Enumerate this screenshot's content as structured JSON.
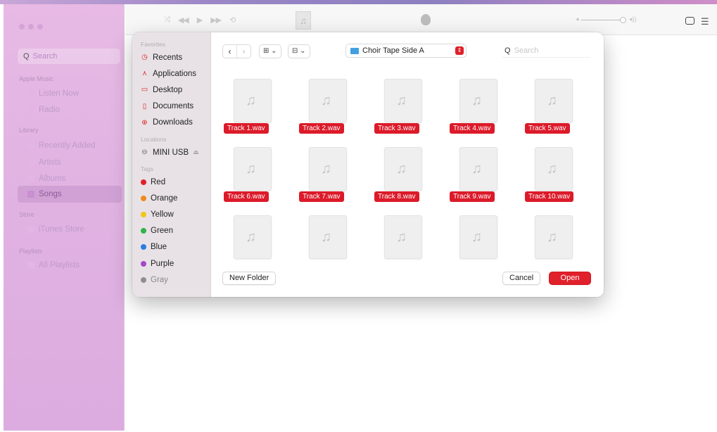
{
  "music": {
    "search_placeholder": "Search",
    "sections": {
      "apple_music": "Apple Music",
      "library": "Library",
      "store": "Store",
      "playlists": "Playlists"
    },
    "items": {
      "listen_now": "Listen Now",
      "radio": "Radio",
      "recently_added": "Recently Added",
      "artists": "Artists",
      "albums": "Albums",
      "songs": "Songs",
      "itunes_store": "iTunes Store",
      "all_playlists": "All Playlists"
    }
  },
  "dialog": {
    "sidebar": {
      "favorites_heading": "Favorites",
      "favorites": [
        "Recents",
        "Applications",
        "Desktop",
        "Documents",
        "Downloads"
      ],
      "locations_heading": "Locations",
      "locations": [
        "MINI USB"
      ],
      "tags_heading": "Tags",
      "tags": [
        {
          "label": "Red",
          "color": "#e0202a"
        },
        {
          "label": "Orange",
          "color": "#f08a1c"
        },
        {
          "label": "Yellow",
          "color": "#f3c51a"
        },
        {
          "label": "Green",
          "color": "#2fb34a"
        },
        {
          "label": "Blue",
          "color": "#2a7de1"
        },
        {
          "label": "Purple",
          "color": "#a448c8"
        },
        {
          "label": "Gray",
          "color": "#8e8e8e"
        }
      ]
    },
    "toolbar": {
      "location": "Choir Tape Side A",
      "search_placeholder": "Search"
    },
    "files": [
      "Track 1.wav",
      "Track 2.wav",
      "Track 3.wav",
      "Track 4.wav",
      "Track 5.wav",
      "Track 6.wav",
      "Track 7.wav",
      "Track 8.wav",
      "Track 9.wav",
      "Track 10.wav",
      "",
      "",
      "",
      "",
      ""
    ],
    "footer": {
      "new_folder": "New Folder",
      "cancel": "Cancel",
      "open": "Open"
    }
  },
  "colors": {
    "accent": "#e0202a",
    "folder": "#42a0e0"
  }
}
